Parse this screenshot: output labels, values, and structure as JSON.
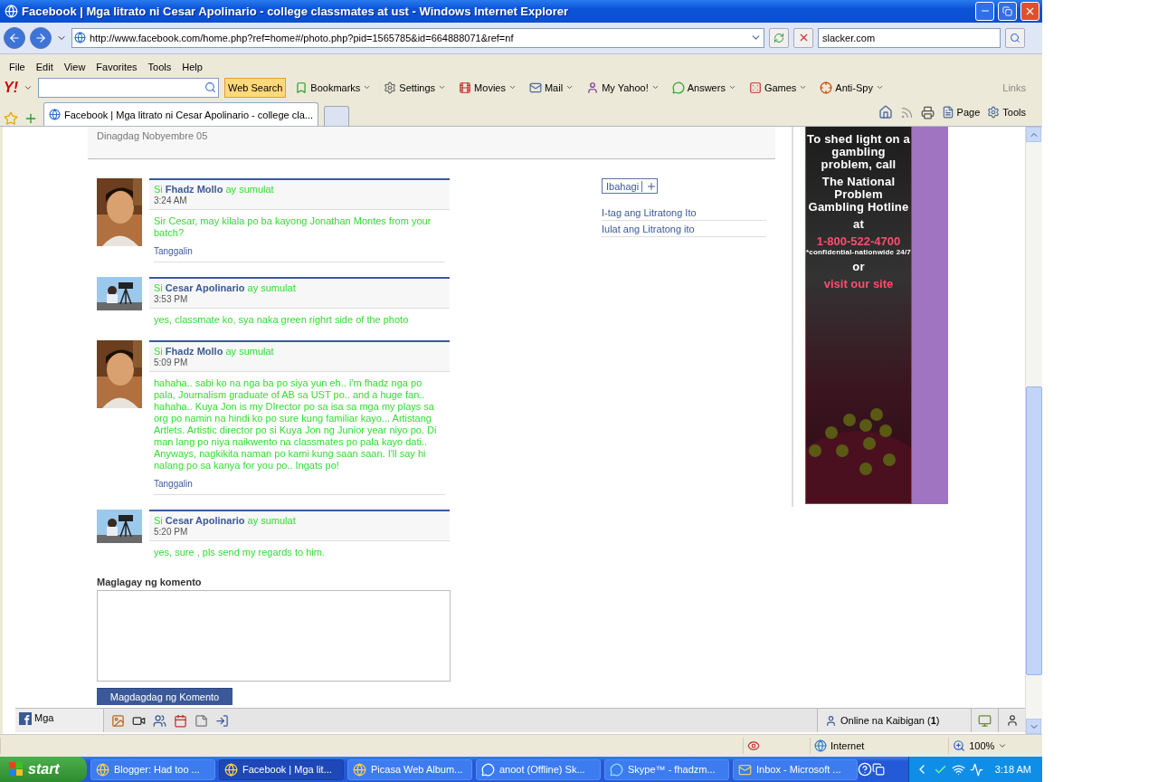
{
  "window": {
    "title": "Facebook | Mga litrato ni Cesar Apolinario - college classmates at ust - Windows Internet Explorer"
  },
  "address_bar": {
    "url": "http://www.facebook.com/home.php?ref=home#/photo.php?pid=1565785&id=664888071&ref=nf",
    "search": "slacker.com"
  },
  "menu": [
    "File",
    "Edit",
    "View",
    "Favorites",
    "Tools",
    "Help"
  ],
  "yahoo_toolbar": {
    "logo": "Y!",
    "search_button": "Web Search",
    "items": [
      "Bookmarks",
      "Settings",
      "Movies",
      "Mail",
      "My Yahoo!",
      "Answers",
      "Games",
      "Anti-Spy"
    ],
    "links": "Links"
  },
  "tabs": [
    {
      "label": "Facebook | Mga litrato ni Cesar Apolinario - college cla...",
      "selected": true
    }
  ],
  "command_bar": [
    "Page",
    "Tools"
  ],
  "photo_info": {
    "added": "Dinagdag Nobyembre 05"
  },
  "comments": [
    {
      "prefix": "Si",
      "author": "Fhadz Mollo",
      "suffix": "ay sumulat",
      "time": "3:24 AM",
      "text": "Sir Cesar, may kilala po ba kayong Jonathan Montes from your batch?",
      "action": "Tanggalin"
    },
    {
      "prefix": "Si",
      "author": "Cesar Apolinario",
      "suffix": "ay sumulat",
      "time": "3:53 PM",
      "text": "yes, classmate ko, sya naka green righrt side of the photo"
    },
    {
      "prefix": "Si",
      "author": "Fhadz Mollo",
      "suffix": "ay sumulat",
      "time": "5:09 PM",
      "text": "hahaha.. sabi ko na nga ba po siya yun eh.. i'm fhadz nga po pala, Journalism graduate of AB sa UST po.. and a huge fan.. hahaha.. Kuya Jon is my DIrector po sa isa sa mga my plays sa org po namin na hindi ko po sure kung familiar kayo... Artistang Artlets. Artistic director po si Kuya Jon ng Junior year niyo po. Di man lang po niya naikwento na classmates po pala kayo dati.. Anyways, nagkikita naman po kami kung saan saan. I'll say hi nalang po sa kanya for you po.. Ingats po!",
      "action": "Tanggalin"
    },
    {
      "prefix": "Si",
      "author": "Cesar Apolinario",
      "suffix": "ay sumulat",
      "time": "5:20 PM",
      "text": "yes, sure , pls send my regards to him."
    }
  ],
  "share_button": "Ibahagi",
  "photo_links": [
    "I-tag ang Litratong Ito",
    "Iulat ang Litratong ito"
  ],
  "comment_form": {
    "label": "Maglagay ng komento",
    "submit": "Magdagdag ng Komento"
  },
  "ad": {
    "blocks": [
      {
        "kind": "headline",
        "text": "To shed light on a gambling problem, call"
      },
      {
        "kind": "headline",
        "text": "The National Problem Gambling Hotline"
      },
      {
        "kind": "headline",
        "text": "at"
      },
      {
        "kind": "accent",
        "text": "1-800-522-4700"
      },
      {
        "kind": "note",
        "text": "*confidential-nationwide 24/7"
      },
      {
        "kind": "headline",
        "text": "or"
      },
      {
        "kind": "accent",
        "text": "visit our site"
      }
    ]
  },
  "chat_bar": {
    "applications": "Mga",
    "online": {
      "label": "Online na Kaibigan",
      "count": "(**1**)"
    }
  },
  "status_bar": {
    "zone": "Internet",
    "zoom": "100%"
  },
  "taskbar": {
    "start": "start",
    "tasks": [
      {
        "label": "Blogger: Had too ...",
        "kind": "browser",
        "selected": false
      },
      {
        "label": "Facebook | Mga lit...",
        "kind": "browser",
        "selected": true
      },
      {
        "label": "Picasa Web Album...",
        "kind": "browser",
        "selected": false
      },
      {
        "label": "anoot (Offline) Sk...",
        "kind": "chat",
        "selected": false
      },
      {
        "label": "Skype™ - fhadzm...",
        "kind": "skype",
        "selected": false
      },
      {
        "label": "Inbox - Microsoft ...",
        "kind": "mail",
        "selected": false
      }
    ],
    "clock": "3:18 AM"
  }
}
